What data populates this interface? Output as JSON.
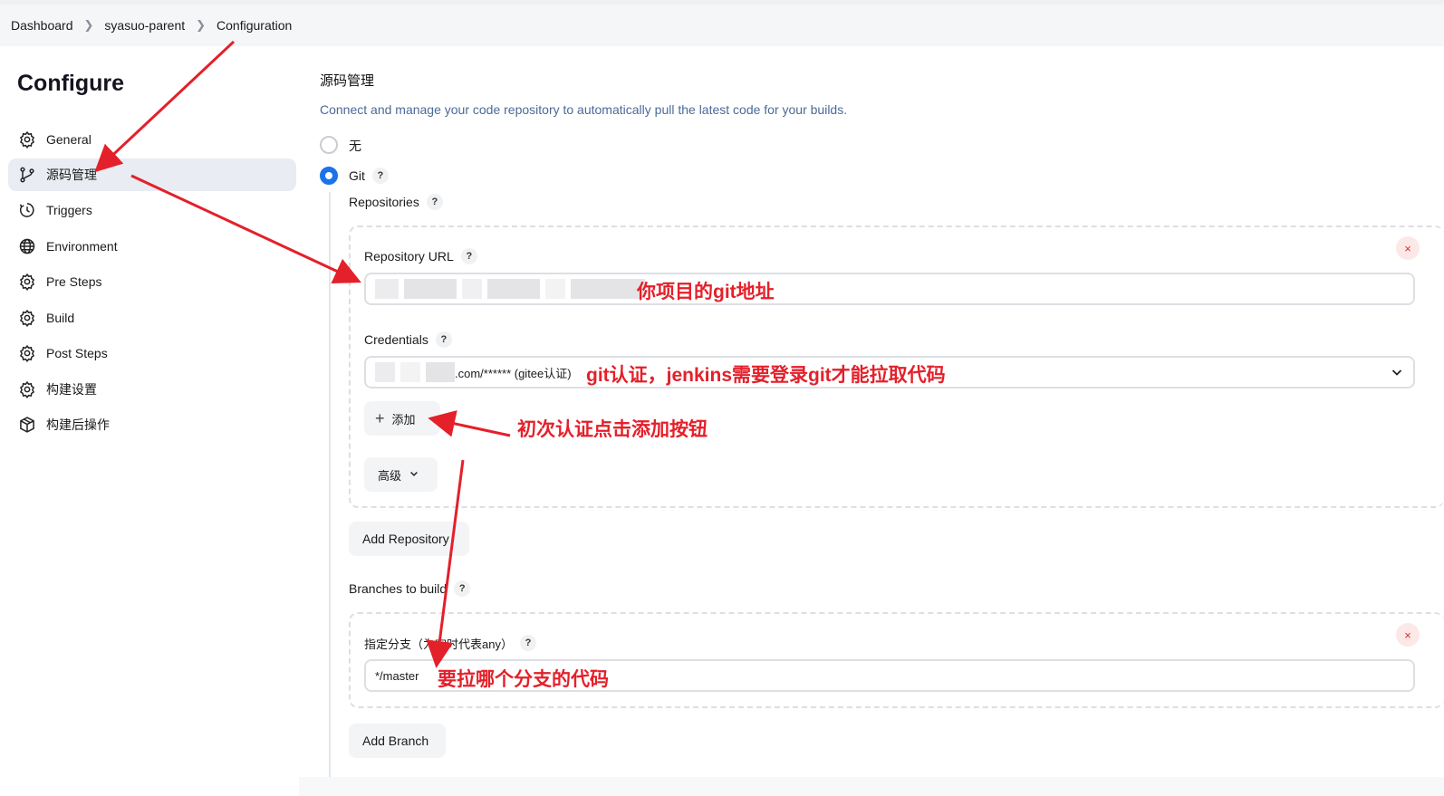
{
  "breadcrumb": {
    "items": [
      "Dashboard",
      "syasuo-parent",
      "Configuration"
    ]
  },
  "page_title": "Configure",
  "sidebar": {
    "items": [
      {
        "label": "General",
        "icon": "gear-icon"
      },
      {
        "label": "源码管理",
        "icon": "branch-icon",
        "active": true
      },
      {
        "label": "Triggers",
        "icon": "clock-icon"
      },
      {
        "label": "Environment",
        "icon": "globe-icon"
      },
      {
        "label": "Pre Steps",
        "icon": "gear-icon"
      },
      {
        "label": "Build",
        "icon": "gear-icon"
      },
      {
        "label": "Post Steps",
        "icon": "gear-icon"
      },
      {
        "label": "构建设置",
        "icon": "gear-icon"
      },
      {
        "label": "构建后操作",
        "icon": "package-icon"
      }
    ]
  },
  "scm": {
    "title": "源码管理",
    "description": "Connect and manage your code repository to automatically pull the latest code for your builds.",
    "options": [
      {
        "label": "无",
        "selected": false
      },
      {
        "label": "Git",
        "selected": true
      }
    ],
    "repositories_label": "Repositories",
    "repository_url_label": "Repository URL",
    "credentials_label": "Credentials",
    "credentials_value": ".com/****** (gitee认证)",
    "add_button": "添加",
    "advanced_button": "高级",
    "add_repository_button": "Add Repository",
    "branches_label": "Branches to build",
    "branch_specifier_label": "指定分支（为空时代表any）",
    "branch_value": "*/master",
    "add_branch_button": "Add Branch",
    "help_glyph": "?",
    "remove_glyph": "×"
  },
  "annotations": {
    "repo_url": "你项目的git地址",
    "credentials": "git认证，jenkins需要登录git才能拉取代码",
    "add": "初次认证点击添加按钮",
    "branch": "要拉哪个分支的代码"
  },
  "colors": {
    "accent": "#1a73e8",
    "annotation": "#e4202a",
    "active_bg": "#e9ecf2"
  }
}
